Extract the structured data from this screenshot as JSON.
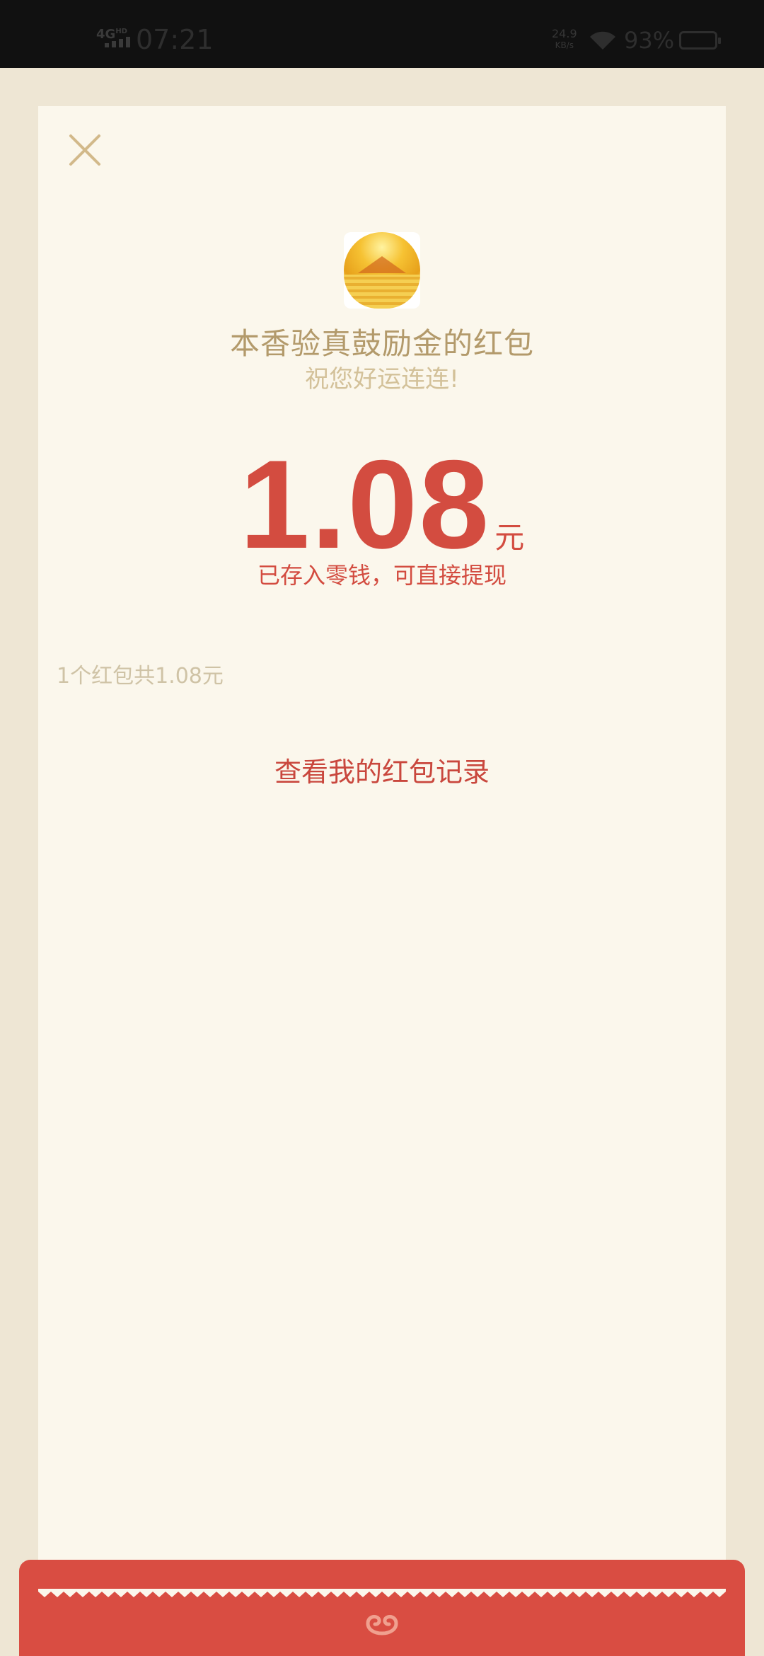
{
  "status_bar": {
    "network": "4G",
    "network_sup": "HD",
    "time": "07:21",
    "speed_value": "24.9",
    "speed_unit": "KB/s",
    "battery_percent": "93%"
  },
  "redpacket": {
    "sender": "本香验真鼓励金的红包",
    "blessing": "祝您好运连连!",
    "amount": "1.08",
    "unit": "元",
    "note": "已存入零钱，可直接提现",
    "summary": "1个红包共1.08元",
    "record_link": "查看我的红包记录"
  },
  "colors": {
    "accent_red": "#D34C40",
    "gold_text": "#B39A6B",
    "card_bg": "#FBF7EC",
    "page_bg": "#EEE6D4"
  },
  "icons": [
    "close-icon",
    "cloud-icon",
    "wifi-icon",
    "battery-icon",
    "signal-icon"
  ]
}
